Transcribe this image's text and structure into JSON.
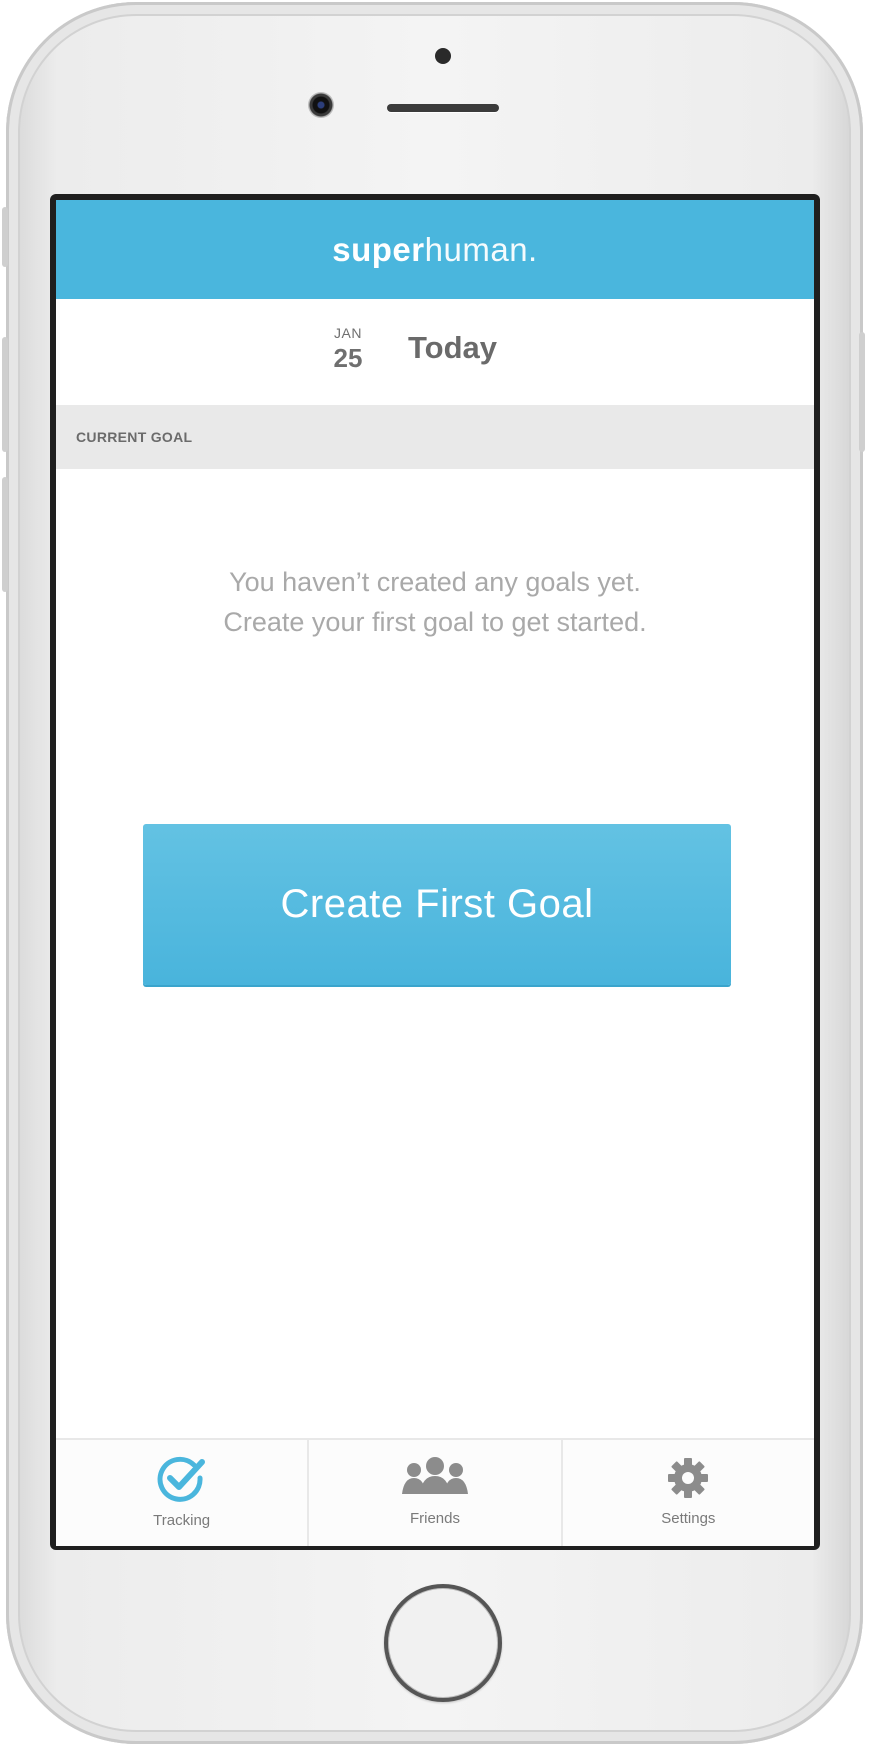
{
  "app": {
    "brand_bold": "super",
    "brand_light": "human."
  },
  "date": {
    "month": "JAN",
    "day": "25",
    "label": "Today"
  },
  "goal_section": {
    "heading": "CURRENT GOAL"
  },
  "empty_state": {
    "line1": "You haven’t created any goals yet.",
    "line2": "Create your first goal to get started."
  },
  "cta": {
    "label": "Create First Goal"
  },
  "tabs": [
    {
      "label": "Tracking",
      "icon": "check-circle-icon",
      "active": true
    },
    {
      "label": "Friends",
      "icon": "people-icon",
      "active": false
    },
    {
      "label": "Settings",
      "icon": "gear-icon",
      "active": false
    }
  ],
  "colors": {
    "accent": "#4ab6dd",
    "tab_active": "#4ab6dd",
    "tab_inactive": "#7a7a7a",
    "goal_bar": "#e9e9e9"
  }
}
